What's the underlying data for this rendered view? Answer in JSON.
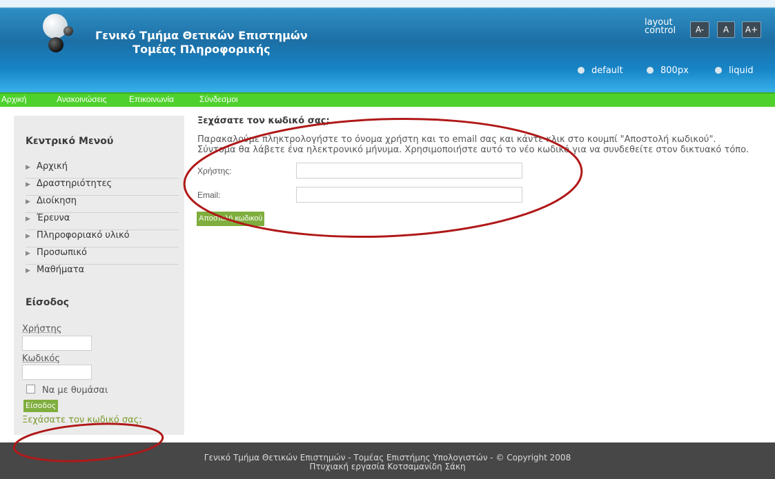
{
  "header": {
    "title_line1": "Γενικό Τμήμα Θετικών Επιστημών",
    "title_line2": "Τομέας Πληροφορικής",
    "layout_control_label": "layout control",
    "size_buttons": [
      "A-",
      "A",
      "A+"
    ],
    "width_options": [
      "default",
      "800px",
      "liquid"
    ]
  },
  "nav": [
    "Αρχική",
    "Ανακοινώσεις",
    "Επικοινωνία",
    "Σύνδεσμοι"
  ],
  "sidebar": {
    "menu_heading": "Κεντρικό Μενού",
    "menu_items": [
      "Αρχική",
      "Δραστηριότητες",
      "Διοίκηση",
      "Έρευνα",
      "Πληροφοριακό υλικό",
      "Προσωπικό",
      "Μαθήματα"
    ],
    "login_heading": "Είσοδος",
    "username_label": "Χρήστης",
    "password_label": "Κωδικός",
    "remember_label": "Να με θυμάσαι",
    "login_button": "Είσοδος",
    "forgot_link": "Ξεχάσατε τον κωδικό σας;"
  },
  "main": {
    "title": "Ξεχάσατε τον κωδικό σας;",
    "intro_line1": "Παρακαλούμε πληκτρολογήστε το όνομα χρήστη και το email σας και κάντε κλικ στο κουμπί \"Αποστολή κωδικού\".",
    "intro_line2": "Σύντομα θα λάβετε ένα ηλεκτρονικό μήνυμα. Χρησιμοποιήστε αυτό το νέο κωδικό για να συνδεθείτε στον δικτυακό τόπο.",
    "username_label": "Χρήστης:",
    "email_label": "Email:",
    "submit_button": "Αποστολή κωδικού"
  },
  "footer": {
    "line1": "Γενικό Τμήμα Θετικών Επιστημών - Τομέας Επιστήμης Υπολογιστών - © Copyright 2008",
    "line2": "Πτυχιακή εργασία Κοτσαμανίδη Σάκη"
  },
  "colors": {
    "header_blue": "#1c6fa5",
    "nav_green": "#4fd12d",
    "button_green": "#7fae3e",
    "footer_gray": "#474747",
    "annotation_red": "#b01818"
  }
}
